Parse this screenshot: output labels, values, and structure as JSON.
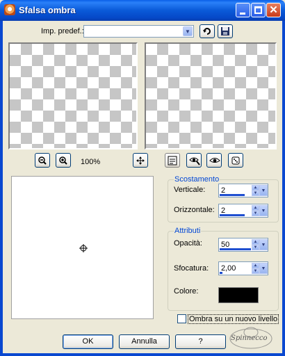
{
  "window": {
    "title": "Sfalsa ombra",
    "title_color": "#0a5ad8"
  },
  "preset": {
    "label": "Imp. predef.:",
    "value": ""
  },
  "zoom": {
    "percent": "100%"
  },
  "offset_group": {
    "title": "Scostamento",
    "vertical_label": "Verticale:",
    "vertical_value": "2",
    "horizontal_label": "Orizzontale:",
    "horizontal_value": "2"
  },
  "attributes_group": {
    "title": "Attributi",
    "opacity_label": "Opacità:",
    "opacity_value": "50",
    "blur_label": "Sfocatura:",
    "blur_value": "2,00",
    "color_label": "Colore:",
    "color_value": "#000000"
  },
  "new_layer_checkbox": {
    "label": "Ombra su un nuovo livello",
    "checked": false
  },
  "buttons": {
    "ok": "OK",
    "cancel": "Annulla",
    "help": "?"
  },
  "icons": {
    "app": "app-icon",
    "minimize": "minimize-icon",
    "maximize": "maximize-icon",
    "close": "close-icon",
    "reset_preset": "reset-arrow-icon",
    "save_preset": "floppy-save-icon",
    "zoom_out": "zoom-out-icon",
    "zoom_in": "zoom-in-icon",
    "pan": "move-icon",
    "proof": "proof-icon",
    "auto_proof": "eye-auto-icon",
    "preview": "eye-icon",
    "randomize": "dice-icon"
  },
  "watermark": {
    "text": "Spinnecco"
  }
}
